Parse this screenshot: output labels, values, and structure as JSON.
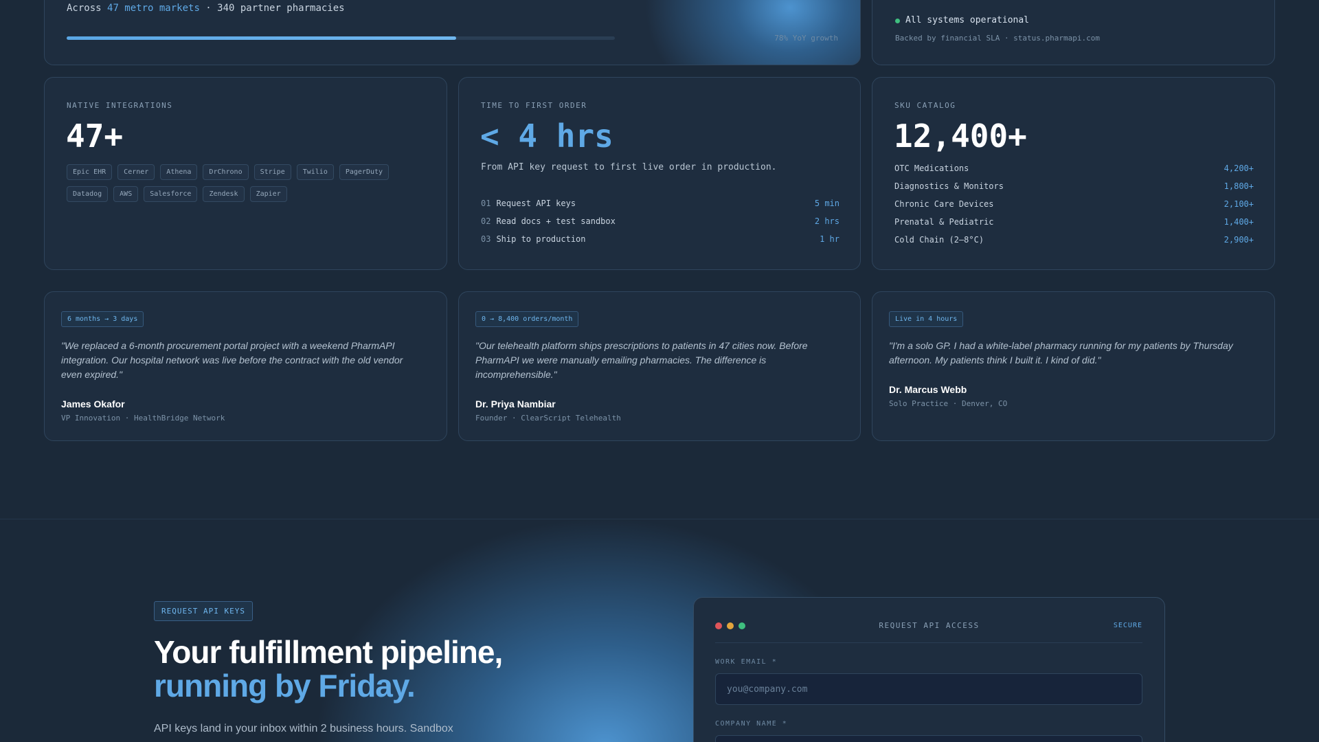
{
  "markets": {
    "prefix": "Across ",
    "highlight": "47 metro markets",
    "suffix": " · 340 partner pharmacies",
    "progress": 0.71,
    "growth": "78% YoY growth"
  },
  "status": {
    "text": "All systems operational",
    "sla": "Backed by financial SLA · status.pharmapi.com",
    "dot_color": "#3fbf7f"
  },
  "integrations": {
    "label": "NATIVE INTEGRATIONS",
    "value": "47+",
    "tags": [
      "Epic EHR",
      "Cerner",
      "Athena",
      "DrChrono",
      "Stripe",
      "Twilio",
      "PagerDuty",
      "Datadog",
      "AWS",
      "Salesforce",
      "Zendesk",
      "Zapier"
    ]
  },
  "ttfo": {
    "label": "TIME TO FIRST ORDER",
    "value": "< 4 hrs",
    "desc": "From API key request to first live order in production.",
    "steps": [
      {
        "num": "01",
        "label": "Request API keys",
        "value": "5 min"
      },
      {
        "num": "02",
        "label": "Read docs + test sandbox",
        "value": "2 hrs"
      },
      {
        "num": "03",
        "label": "Ship to production",
        "value": "1 hr"
      }
    ]
  },
  "sku": {
    "label": "SKU CATALOG",
    "value": "12,400+",
    "rows": [
      {
        "label": "OTC Medications",
        "value": "4,200+"
      },
      {
        "label": "Diagnostics & Monitors",
        "value": "1,800+"
      },
      {
        "label": "Chronic Care Devices",
        "value": "2,100+"
      },
      {
        "label": "Prenatal & Pediatric",
        "value": "1,400+"
      },
      {
        "label": "Cold Chain (2–8°C)",
        "value": "2,900+"
      }
    ]
  },
  "testimonials": [
    {
      "badge": "6 months → 3 days",
      "quote": "\"We replaced a 6-month procurement portal project with a weekend PharmAPI integration. Our hospital network was live before the contract with the old vendor even expired.\"",
      "author": "James Okafor",
      "role": "VP Innovation · HealthBridge Network"
    },
    {
      "badge": "0 → 8,400 orders/month",
      "quote": "\"Our telehealth platform ships prescriptions to patients in 47 cities now. Before PharmAPI we were manually emailing pharmacies. The difference is incomprehensible.\"",
      "author": "Dr. Priya Nambiar",
      "role": "Founder · ClearScript Telehealth"
    },
    {
      "badge": "Live in 4 hours",
      "quote": "\"I'm a solo GP. I had a white-label pharmacy running for my patients by Thursday afternoon. My patients think I built it. I kind of did.\"",
      "author": "Dr. Marcus Webb",
      "role": "Solo Practice · Denver, CO"
    }
  ],
  "cta": {
    "pill": "REQUEST API KEYS",
    "headline": "Your fulfillment pipeline,",
    "headline_accent": "running by Friday.",
    "sub": "API keys land in your inbox within 2 business hours. Sandbox"
  },
  "form": {
    "title": "REQUEST API ACCESS",
    "secure": "SECURE",
    "dot_colors": [
      "#e0555a",
      "#e3a43c",
      "#3fbf7f"
    ],
    "email_label": "WORK EMAIL *",
    "email_placeholder": "you@company.com",
    "company_label": "COMPANY NAME *"
  }
}
